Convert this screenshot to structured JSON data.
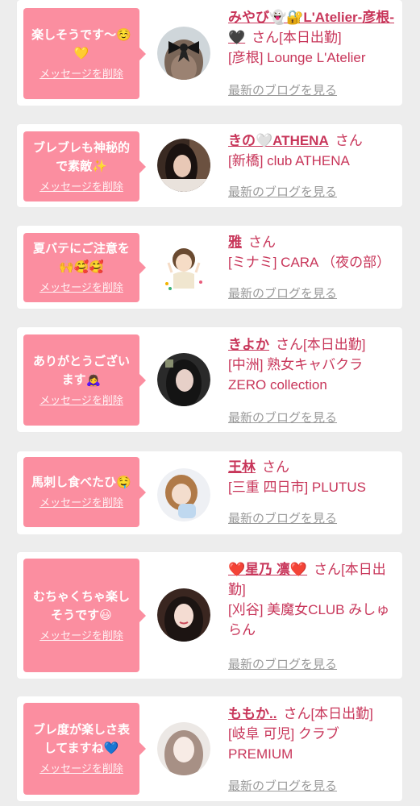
{
  "delete_label": "メッセージを削除",
  "blog_label": "最新のブログを見る",
  "honorific": "さん",
  "colors": {
    "bubble": "#fb8ea0",
    "name": "#c8365a",
    "background": "#ededed"
  },
  "entries": [
    {
      "message": "楽しそうです〜☺️💛",
      "name": "みやび👻🔐L'Atelier-彦根-🖤",
      "status": "[本日出勤]",
      "shop": "[彦根] Lounge L'Atelier",
      "avatar_icon": "black-bow-hairclip-photo"
    },
    {
      "message": "ブレブレも神秘的で素敵✨",
      "name": "きの🤍ATHENA",
      "status": "",
      "shop": "[新橋] club ATHENA",
      "avatar_icon": "woman-selfie-photo"
    },
    {
      "message": "夏バテにご注意を🙌🥰🥰",
      "name": "雅",
      "status": "",
      "shop": "[ミナミ] CARA （夜の部）",
      "avatar_icon": "cartoon-girl-illustration"
    },
    {
      "message": "ありがとうございます🙇‍♀️",
      "name": "きよか",
      "status": "[本日出勤]",
      "shop": "[中洲] 熟女キャバクラ ZERO collection",
      "avatar_icon": "woman-night-selfie-photo"
    },
    {
      "message": "馬刺し食べたひ🤤",
      "name": "王林",
      "status": "",
      "shop": "[三重 四日市] PLUTUS",
      "avatar_icon": "woman-peace-sign-photo"
    },
    {
      "message": "むちゃくちゃ楽しそうです😃",
      "name": "❤️星乃 凛❤️",
      "status": "[本日出勤]",
      "shop": "[刈谷] 美魔女CLUB みしゅらん",
      "avatar_icon": "woman-portrait-photo"
    },
    {
      "message": "ブレ度が楽しさ表してますね💙",
      "name": "ももか..",
      "status": "[本日出勤]",
      "shop": "[岐阜 可児] クラブ PREMIUM",
      "avatar_icon": "woman-soft-focus-photo"
    }
  ]
}
